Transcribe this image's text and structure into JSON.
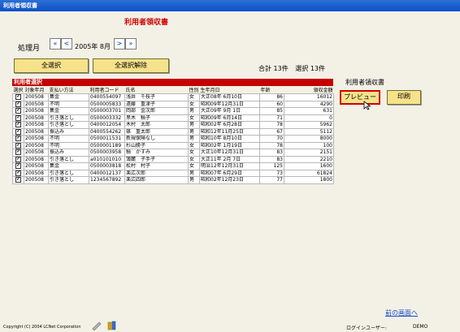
{
  "window": {
    "title": "利用者領収書"
  },
  "form": {
    "title": "利用者領収書",
    "period_label": "処理月",
    "period_value": "2005年 8月",
    "nav_first": "«",
    "nav_prev": "<",
    "nav_next": ">",
    "nav_last": "»",
    "select_all": "全選択",
    "deselect_all": "全選択解除",
    "total_text": "合計 13件",
    "selected_text": "選択 13件"
  },
  "list": {
    "header": "利用者選択",
    "columns": [
      "選択",
      "対象年月",
      "支払い方法",
      "利用者コード",
      "氏名",
      "性別",
      "生年月日",
      "年齢",
      "領収金額"
    ],
    "rows": [
      [
        "✔",
        "200508",
        "集金",
        "0400554097",
        "浅井　千枝子",
        "女",
        "大正08年 6月10日",
        "86",
        "16012"
      ],
      [
        "✔",
        "200508",
        "不明",
        "0500005833",
        "遠藤　重津子",
        "女",
        "昭和09年12月31日",
        "60",
        "4290"
      ],
      [
        "✔",
        "200508",
        "集金",
        "0500003701",
        "岡部　金次郎",
        "男",
        "大正09年 9月 1日",
        "85",
        "631"
      ],
      [
        "✔",
        "200508",
        "引き落とし",
        "0500003332",
        "黒木　積子",
        "女",
        "昭和09年 6月14日",
        "71",
        "0"
      ],
      [
        "✔",
        "200508",
        "引き落とし",
        "0400012054",
        "木村　太郎",
        "男",
        "昭和02年 6月28日",
        "78",
        "5962"
      ],
      [
        "✔",
        "200508",
        "振込み",
        "0400554262",
        "篠　重太郎",
        "男",
        "昭和12年11月25日",
        "67",
        "5112"
      ],
      [
        "✔",
        "200508",
        "不明",
        "0500011531",
        "新規保険なし",
        "男",
        "昭和10年 8月10日",
        "70",
        "8000"
      ],
      [
        "✔",
        "200508",
        "不明",
        "0500001189",
        "杉山勝子",
        "女",
        "昭和02年 1月19日",
        "78",
        "100"
      ],
      [
        "✔",
        "200508",
        "振込み",
        "0500003958",
        "積　かすみ",
        "女",
        "大正10年12月31日",
        "83",
        "2151"
      ],
      [
        "✔",
        "200508",
        "引き落とし",
        "a010101010",
        "簿麓　子手子",
        "女",
        "大正11年 2月 7日",
        "83",
        "2210"
      ],
      [
        "✔",
        "200508",
        "集金",
        "0500003818",
        "松村　村子",
        "女",
        "明治12年12月31日",
        "125",
        "1600"
      ],
      [
        "✔",
        "200508",
        "引き落とし",
        "0400012137",
        "楽広次郎",
        "男",
        "昭和07年 6月29日",
        "73",
        "61824"
      ],
      [
        "✔",
        "200508",
        "引き落とし",
        "1234567892",
        "楽広四郎",
        "男",
        "昭和02年12月23日",
        "77",
        "1800"
      ]
    ]
  },
  "side": {
    "section_label": "利用者領収書",
    "preview_button": "プレビュー",
    "print_button": "印刷"
  },
  "footer": {
    "back_link": "前の画面へ",
    "copyright": "Copyright (C) 2004 LCNet Corporation",
    "login_label": "ログインユーザー:",
    "login_user": "DEMO"
  }
}
